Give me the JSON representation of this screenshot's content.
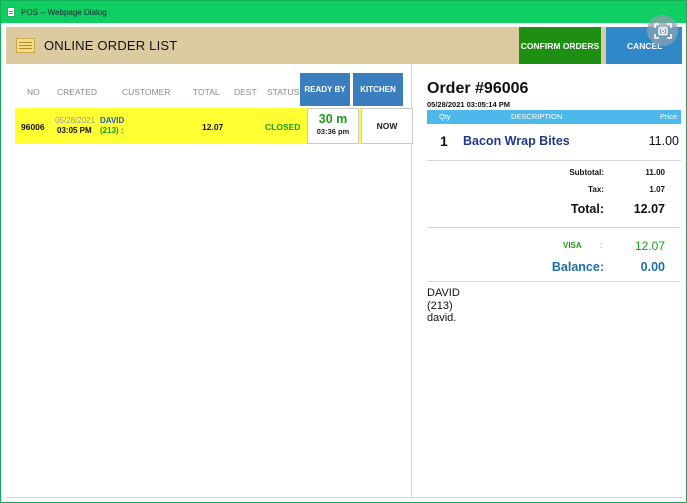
{
  "window": {
    "title": "POS -- Webpage Dialog"
  },
  "header": {
    "title": "ONLINE ORDER LIST",
    "confirm_label": "CONFIRM ORDERS",
    "cancel_label": "CANCEL"
  },
  "order_list": {
    "columns": {
      "no": "NO",
      "created": "CREATED",
      "customer": "CUSTOMER",
      "total": "TOTAL",
      "dest": "DEST",
      "status": "STATUS",
      "ready_by": "READY BY",
      "kitchen": "KITCHEN"
    },
    "rows": [
      {
        "no": "96006",
        "created_date": "05/28/2021",
        "created_time": "03:05 PM",
        "customer_name": "DAVID",
        "customer_phone": "(213) :",
        "total": "12.07",
        "dest": "",
        "status": "CLOSED",
        "ready_minutes": "30 m",
        "ready_time": "03:36 pm",
        "kitchen": "NOW"
      }
    ]
  },
  "order_detail": {
    "title": "Order #96006",
    "datetime": "05/28/2021 03:05:14 PM",
    "item_header": {
      "qty": "Qty",
      "description": "DESCRIPTION",
      "price": "Price"
    },
    "items": [
      {
        "qty": "1",
        "description": "Bacon Wrap Bites",
        "price": "11.00"
      }
    ],
    "subtotal_label": "Subtotal:",
    "subtotal": "11.00",
    "tax_label": "Tax:",
    "tax": "1.07",
    "total_label": "Total:",
    "total": "12.07",
    "payment_method": "VISA",
    "payment_sep": ":",
    "payment_amount": "12.07",
    "balance_label": "Balance:",
    "balance": "0.00",
    "customer_name": "DAVID",
    "customer_phone": "(213)",
    "customer_email": "david."
  },
  "colors": {
    "titlebar": "#0fcf62",
    "header_bg": "#dccba0",
    "confirm_button": "#1f8f14",
    "cancel_button": "#2f88c8",
    "selected_row": "#ffff33",
    "item_header": "#4db8ea",
    "status_closed": "#1a9c1a",
    "balance": "#1f6fa8"
  },
  "icons": {
    "titlebar": "page-icon",
    "header": "order-list-icon",
    "overlay": "screenshot-capture-icon"
  }
}
